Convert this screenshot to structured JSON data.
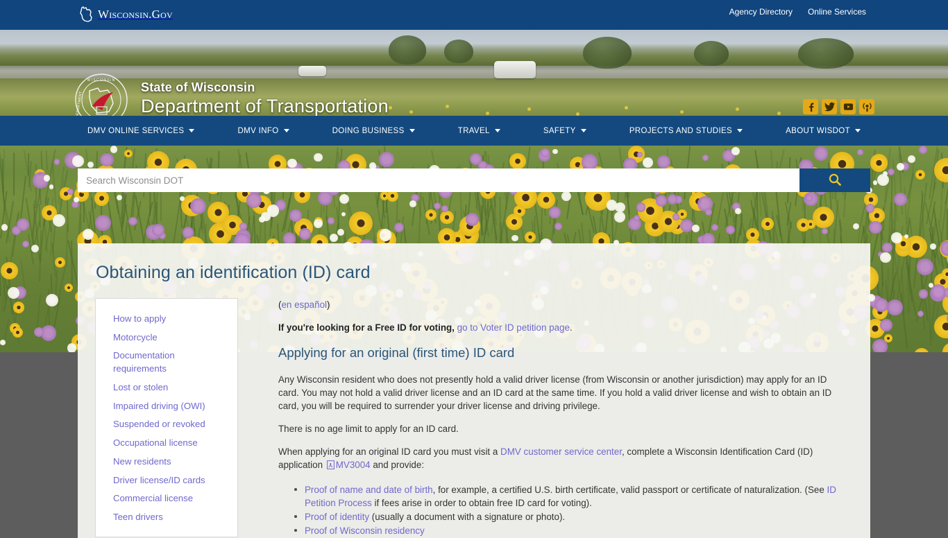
{
  "topbar": {
    "logo_text": "Wisconsin.Gov",
    "logo_icon": "wisconsin-state-outline-icon",
    "links": [
      {
        "label": "Agency Directory"
      },
      {
        "label": "Online Services"
      }
    ]
  },
  "masthead": {
    "seal_icon": "wisdot-department-seal-icon",
    "line1": "State of Wisconsin",
    "line2": "Department of Transportation",
    "social": [
      {
        "name": "facebook-icon",
        "glyph": "f",
        "label": "Facebook"
      },
      {
        "name": "twitter-icon",
        "glyph": "ᴠ",
        "label": "Twitter"
      },
      {
        "name": "youtube-icon",
        "glyph": "▶",
        "label": "YouTube"
      },
      {
        "name": "podcast-icon",
        "glyph": "◉",
        "label": "Podcast"
      }
    ]
  },
  "mainnav": {
    "items": [
      {
        "label": "DMV ONLINE SERVICES",
        "has_dropdown": true
      },
      {
        "label": "DMV INFO",
        "has_dropdown": true
      },
      {
        "label": "DOING BUSINESS",
        "has_dropdown": true
      },
      {
        "label": "TRAVEL",
        "has_dropdown": true
      },
      {
        "label": "SAFETY",
        "has_dropdown": true
      },
      {
        "label": "PROJECTS AND STUDIES",
        "has_dropdown": true
      },
      {
        "label": "ABOUT WISDOT",
        "has_dropdown": true
      }
    ]
  },
  "search": {
    "placeholder": "Search Wisconsin DOT",
    "value": "",
    "button_icon": "search-magnifier-icon"
  },
  "page": {
    "title": "Obtaining an identification (ID) card"
  },
  "sidebar": {
    "items": [
      {
        "label": "How to apply"
      },
      {
        "label": "Motorcycle"
      },
      {
        "label": "Documentation requirements"
      },
      {
        "label": "Lost or stolen"
      },
      {
        "label": "Impaired driving (OWI)"
      },
      {
        "label": "Suspended or revoked"
      },
      {
        "label": "Occupational license"
      },
      {
        "label": "New residents"
      },
      {
        "label": "Driver license/ID cards"
      },
      {
        "label": "Commercial license"
      },
      {
        "label": "Teen drivers"
      }
    ]
  },
  "content": {
    "espanol_open": "(",
    "espanol_link": "en español",
    "espanol_close": ")",
    "free_id_bold": "If you're looking for a Free ID for voting,",
    "free_id_link": "go to Voter ID petition page",
    "free_id_period": ".",
    "heading": "Applying for an original (first time) ID card",
    "para1": "Any Wisconsin resident who does not presently hold a valid driver license (from Wisconsin or another jurisdiction) may apply for an ID card. You may not hold a valid driver license and an ID card at the same time. If you hold a valid driver license and wish to obtain an ID card, you will be required to surrender your driver license and driving privilege.",
    "para2": "There is no age limit to apply for an ID card.",
    "para3_a": "When applying for an original ID card you must visit a ",
    "para3_link1": "DMV customer service center",
    "para3_b": ", complete a Wisconsin Identification Card (ID) application ",
    "para3_pdf_icon": "pdf-file-icon",
    "para3_link2": "MV3004",
    "para3_c": " and provide:",
    "bullets": [
      {
        "link": "Proof of name and date of birth",
        "text_a": ", for example, a certified U.S. birth certificate, valid passport or certificate of naturalization. (See ",
        "link2": "ID Petition Process",
        "text_b": " if fees arise in order to obtain free ID card for voting)."
      },
      {
        "link": "Proof of identity",
        "text_a": " (usually a document with a signature or photo).",
        "link2": "",
        "text_b": ""
      },
      {
        "link": "Proof of Wisconsin residency",
        "text_a": "",
        "link2": "",
        "text_b": ""
      }
    ]
  },
  "colors": {
    "gov_blue": "#10457e",
    "nav_blue": "#13497f",
    "heading_blue": "#2a5579",
    "link_purple": "#6f68cc",
    "social_gold": "#e5a817",
    "page_bg_gray": "#5d5d5d"
  }
}
